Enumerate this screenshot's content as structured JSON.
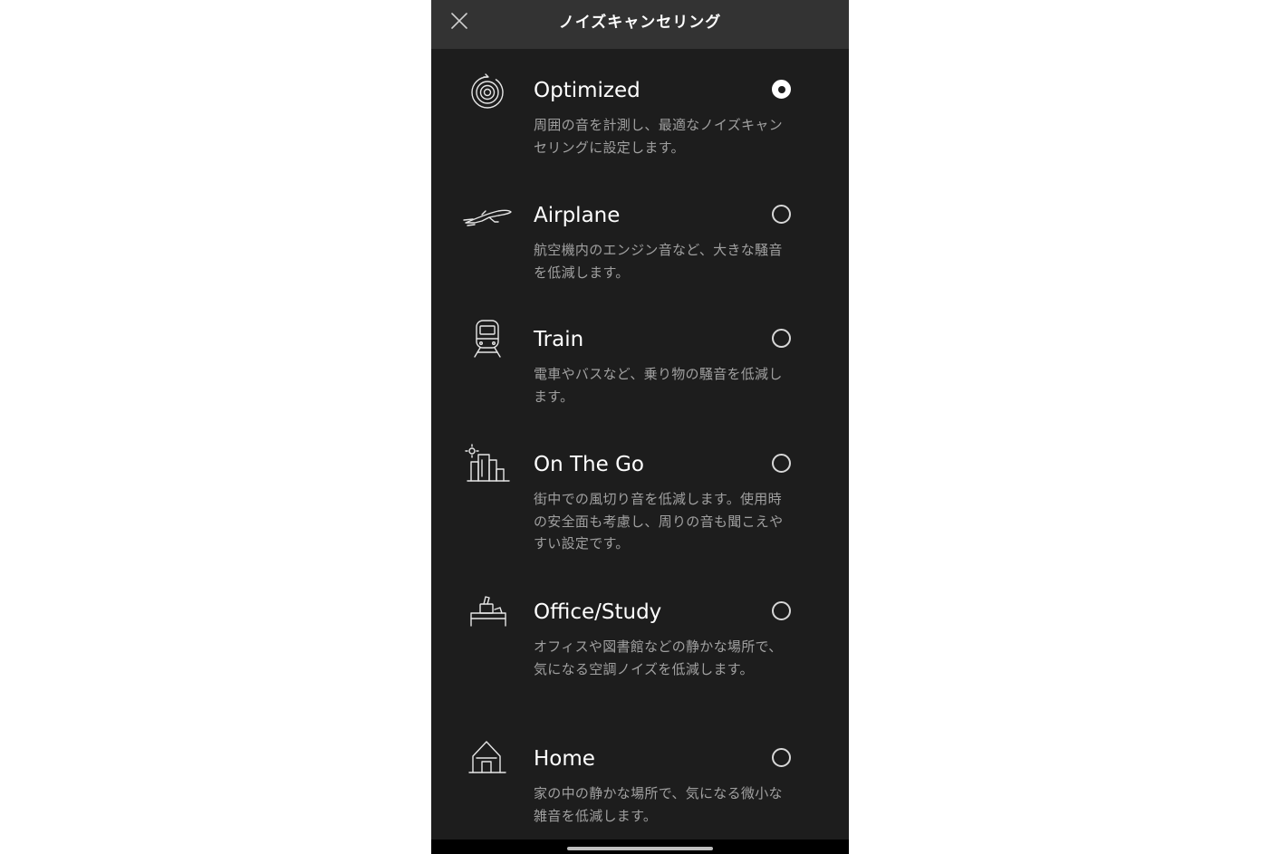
{
  "header": {
    "title": "ノイズキャンセリング",
    "close_icon": "close-icon"
  },
  "options": [
    {
      "id": "optimized",
      "icon": "optimized-icon",
      "label": "Optimized",
      "description": "周囲の音を計測し、最適なノイズキャンセリングに設定します。",
      "selected": true
    },
    {
      "id": "airplane",
      "icon": "airplane-icon",
      "label": "Airplane",
      "description": "航空機内のエンジン音など、大きな騒音を低減します。",
      "selected": false
    },
    {
      "id": "train",
      "icon": "train-icon",
      "label": "Train",
      "description": "電車やバスなど、乗り物の騒音を低減します。",
      "selected": false
    },
    {
      "id": "on-the-go",
      "icon": "city-icon",
      "label": "On The Go",
      "description": "街中での風切り音を低減します。使用時の安全面も考慮し、周りの音も聞こえやすい設定です。",
      "selected": false
    },
    {
      "id": "office-study",
      "icon": "office-desk-icon",
      "label": "Office/Study",
      "description": "オフィスや図書館などの静かな場所で、気になる空調ノイズを低減します。",
      "selected": false
    },
    {
      "id": "home",
      "icon": "home-icon",
      "label": "Home",
      "description": "家の中の静かな場所で、気になる微小な雑音を低減します。",
      "selected": false
    }
  ],
  "colors": {
    "background": "#1d1d1d",
    "header": "#333333",
    "label": "#ffffff",
    "description": "#a0a0a0"
  }
}
